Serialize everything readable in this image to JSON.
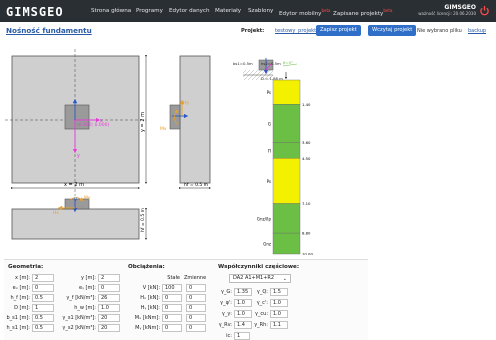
{
  "nav": {
    "logo": "GIMSGEO",
    "items": [
      {
        "label": "Strona główna",
        "badge": ""
      },
      {
        "label": "Programy",
        "badge": ""
      },
      {
        "label": "Edytor danych",
        "badge": ""
      },
      {
        "label": "Materiały",
        "badge": ""
      },
      {
        "label": "Szablony",
        "badge": ""
      },
      {
        "label": "Edytor mobilny",
        "badge": "beta"
      },
      {
        "label": "Zapisane projekty",
        "badge": "beta"
      }
    ],
    "brand": "GIMSGEO",
    "license": "ważność licencji: 20.06.2030"
  },
  "header": {
    "title": "Nośność fundamentu",
    "project_label": "Projekt:",
    "project_name": "testowy_projekt",
    "save_button": "Zapisz projekt",
    "load_button": "Wczytaj projekt",
    "no_file": "Nie wybrano pliku",
    "backup": "backup"
  },
  "drawing": {
    "plan_width_label": "x = 2 m",
    "plan_depth_label": "y = 2 m",
    "load_point_label": "(0.000; 0.000)",
    "side_height_label": "hf = 0.5 m",
    "elev_height_label": "hf = 0.5 m",
    "force_labels": {
      "hy": "Hy",
      "mx": "Mx",
      "hx": "Hx",
      "my": "My",
      "v": "V"
    },
    "top_labels": {
      "bs": "bs1=0.5m",
      "hs": "hs2=0.5m",
      "angle": "β=0°",
      "depth": "D = 1.88 m"
    }
  },
  "layers": [
    {
      "name": "Ps",
      "bottom": "1.40",
      "color": "#f3f000"
    },
    {
      "name": "G",
      "bottom": "3.60",
      "color": "#6cbf45"
    },
    {
      "name": "Π",
      "bottom": "4.50",
      "color": "#6cbf45"
    },
    {
      "name": "Ps",
      "bottom": "7.10",
      "color": "#f3f000"
    },
    {
      "name": "Gnz//Ip",
      "bottom": "8.80",
      "color": "#6cbf45"
    },
    {
      "name": "Gnz",
      "bottom": "10.00",
      "color": "#6cbf45"
    }
  ],
  "geometry": {
    "title": "Geometria:",
    "x_label": "x [m]:",
    "x_value": "2",
    "y_label": "y [m]:",
    "y_value": "2",
    "ex_label": "eₓ [m]:",
    "ex_value": "0",
    "ey_label": "eᵧ [m]:",
    "ey_value": "0",
    "hf_label": "h_f [m]:",
    "hf_value": "0.5",
    "gf_label": "γ_f [kN/m³]:",
    "gf_value": "26",
    "d_label": "D [m]:",
    "d_value": "1",
    "hw_label": "h_w [m]:",
    "hw_value": "1.0",
    "bs1_label": "b_s1 [m]:",
    "bs1_value": "0.5",
    "gs1_label": "γ_s1 [kN/m³]:",
    "gs1_value": "20",
    "hs1_label": "h_s1 [m]:",
    "hs1_value": "0.5",
    "gs2_label": "γ_s2 [kN/m³]:",
    "gs2_value": "20"
  },
  "loads": {
    "title": "Obciążenia:",
    "col_static": "Stałe",
    "col_variable": "Zmienne",
    "rows": [
      {
        "label": "V [kN]:",
        "static": "100",
        "variable": "0"
      },
      {
        "label": "Hₓ [kN]:",
        "static": "0",
        "variable": "0"
      },
      {
        "label": "Hᵧ [kN]:",
        "static": "0",
        "variable": "0"
      },
      {
        "label": "Mₓ [kNm]:",
        "static": "0",
        "variable": "0"
      },
      {
        "label": "Mᵧ [kNm]:",
        "static": "0",
        "variable": "0"
      }
    ]
  },
  "factors": {
    "title": "Współczynniki częściowe:",
    "approach": "DA2 A1+M1+R2",
    "rows": [
      {
        "l1": "γ_G:",
        "v1": "1.35",
        "l2": "γ_Q:",
        "v2": "1.5"
      },
      {
        "l1": "γ_φ':",
        "v1": "1.0",
        "l2": "γ_c':",
        "v2": "1.0"
      },
      {
        "l1": "γ_γ:",
        "v1": "1.0",
        "l2": "γ_cu:",
        "v2": "1.0"
      },
      {
        "l1": "γ_Rv:",
        "v1": "1.4",
        "l2": "γ_Rh:",
        "v2": "1.1"
      }
    ],
    "k_label": "ic:",
    "k_value": "1"
  },
  "colors": {
    "concrete": "#c8c8c8",
    "soil_yellow": "#f3f000",
    "soil_green": "#6cbf45",
    "load_magenta": "#e63bd8",
    "load_orange": "#e8a02a",
    "nav_bg": "#2a2f33",
    "accent": "#2f6fc8"
  }
}
